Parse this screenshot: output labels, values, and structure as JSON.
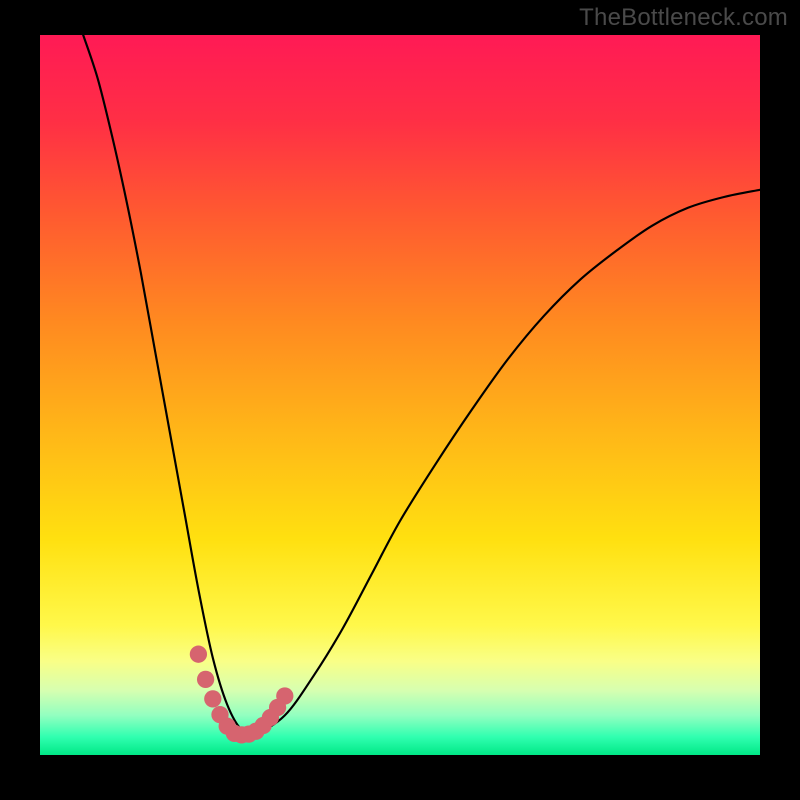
{
  "watermark": "TheBottleneck.com",
  "colors": {
    "background": "#000000",
    "gradient_stops": [
      {
        "offset": 0.0,
        "color": "#ff1a55"
      },
      {
        "offset": 0.12,
        "color": "#ff2f45"
      },
      {
        "offset": 0.25,
        "color": "#ff5a30"
      },
      {
        "offset": 0.4,
        "color": "#ff8a20"
      },
      {
        "offset": 0.55,
        "color": "#ffb618"
      },
      {
        "offset": 0.7,
        "color": "#ffe010"
      },
      {
        "offset": 0.82,
        "color": "#fff84a"
      },
      {
        "offset": 0.87,
        "color": "#f9ff87"
      },
      {
        "offset": 0.91,
        "color": "#d7ffb0"
      },
      {
        "offset": 0.945,
        "color": "#92ffc0"
      },
      {
        "offset": 0.975,
        "color": "#30ffb0"
      },
      {
        "offset": 1.0,
        "color": "#00e886"
      }
    ],
    "curve": "#000000",
    "marker": "#d6646f"
  },
  "chart_data": {
    "type": "line",
    "title": "",
    "xlabel": "",
    "ylabel": "",
    "xlim": [
      0,
      1000
    ],
    "ylim": [
      0,
      1000
    ],
    "series": [
      {
        "name": "bottleneck-curve",
        "x": [
          60,
          80,
          100,
          120,
          140,
          160,
          180,
          200,
          220,
          240,
          260,
          280,
          300,
          340,
          380,
          420,
          460,
          500,
          550,
          600,
          650,
          700,
          750,
          800,
          850,
          900,
          950,
          1000
        ],
        "y": [
          1000,
          940,
          860,
          770,
          670,
          560,
          450,
          340,
          230,
          135,
          70,
          35,
          30,
          55,
          110,
          175,
          250,
          325,
          405,
          480,
          550,
          610,
          660,
          700,
          735,
          760,
          775,
          785
        ]
      }
    ],
    "markers": {
      "name": "highlighted-points",
      "x": [
        220,
        230,
        240,
        250,
        260,
        270,
        280,
        290,
        300,
        310,
        320,
        330,
        340
      ],
      "y": [
        140,
        105,
        78,
        56,
        40,
        30,
        28,
        29,
        33,
        41,
        52,
        66,
        82
      ]
    },
    "legend": false,
    "grid": false
  }
}
